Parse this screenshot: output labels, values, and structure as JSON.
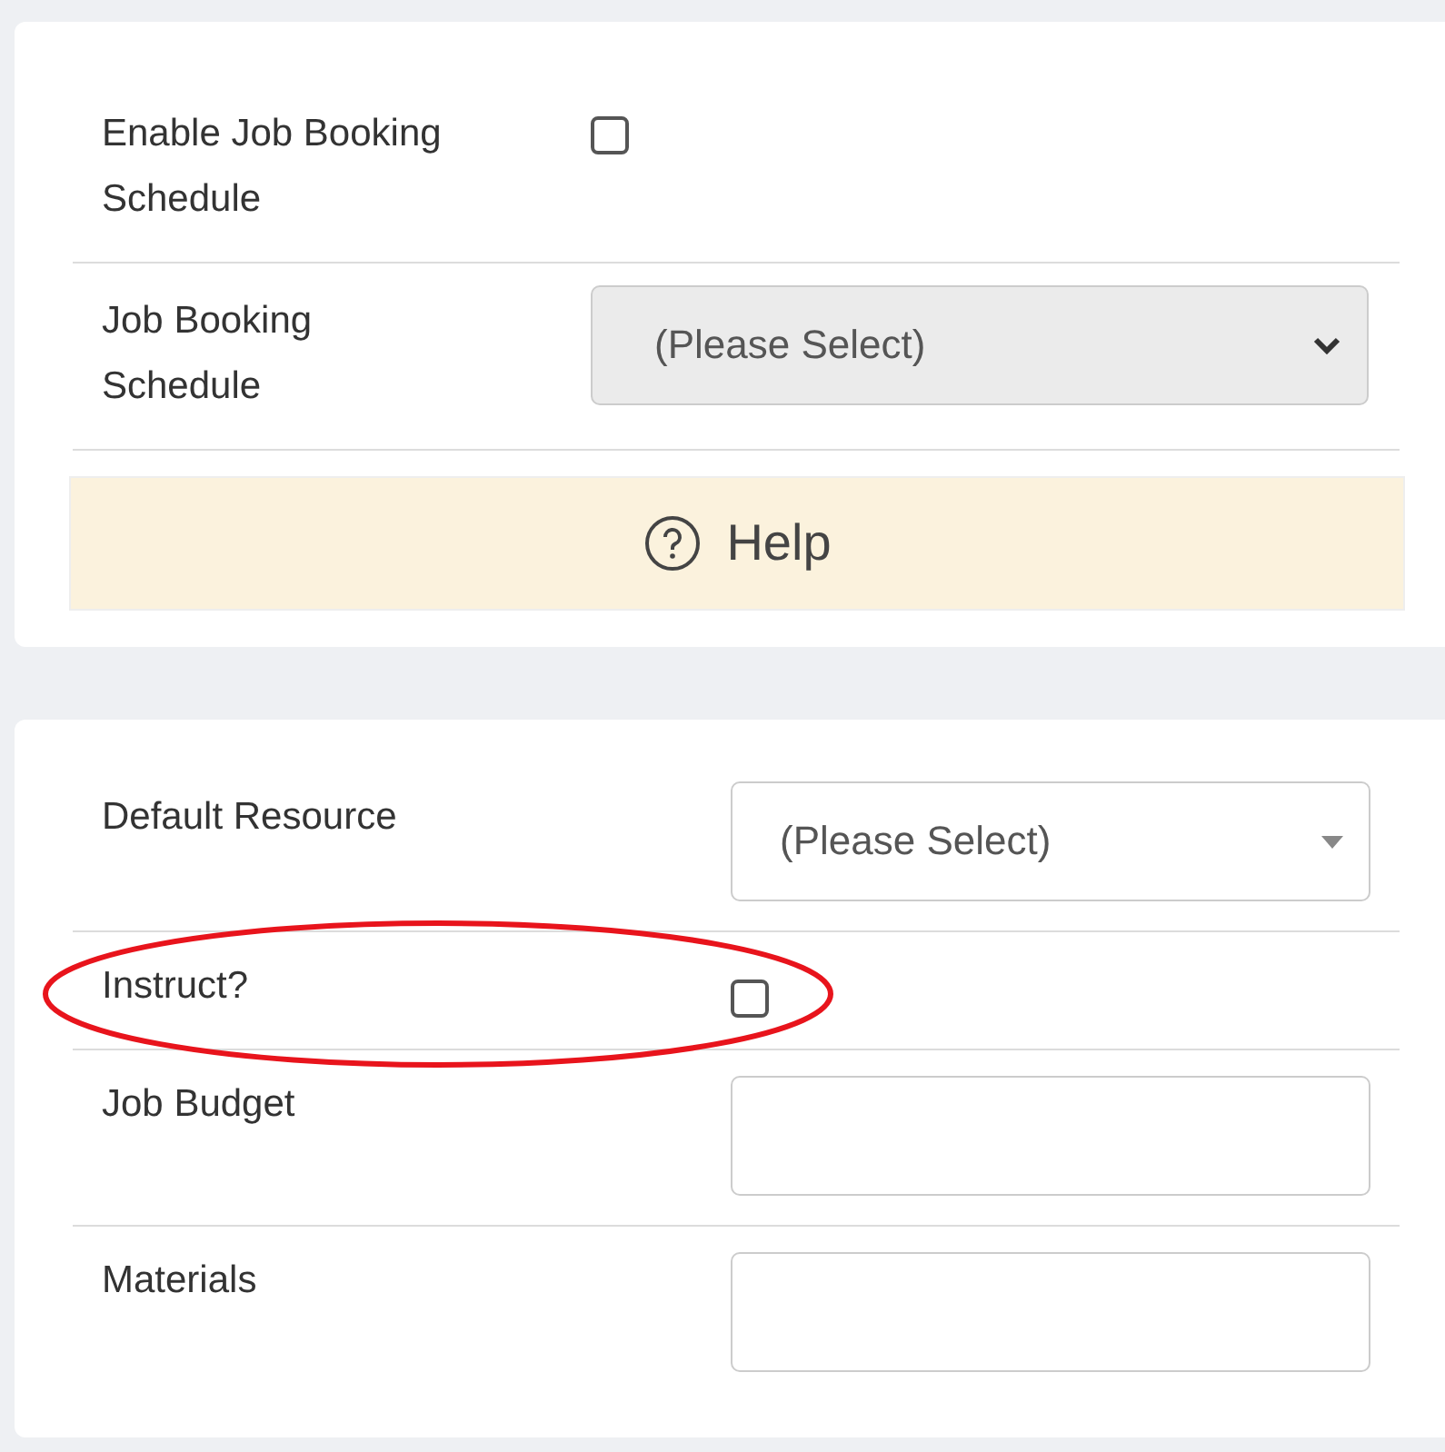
{
  "sections": [
    {
      "fields": [
        {
          "kind": "checkbox",
          "label": "Enable Job Booking Schedule",
          "checked": false
        },
        {
          "kind": "select",
          "label": "Job Booking Schedule",
          "value": "(Please Select)",
          "disabled": true
        }
      ],
      "help": {
        "label": "Help"
      }
    },
    {
      "fields": [
        {
          "kind": "select",
          "label": "Default Resource",
          "value": "(Please Select)",
          "disabled": false
        },
        {
          "kind": "checkbox",
          "label": "Instruct?",
          "checked": false,
          "highlighted": true
        },
        {
          "kind": "input",
          "label": "Job Budget"
        },
        {
          "kind": "input",
          "label": "Materials"
        }
      ]
    }
  ]
}
